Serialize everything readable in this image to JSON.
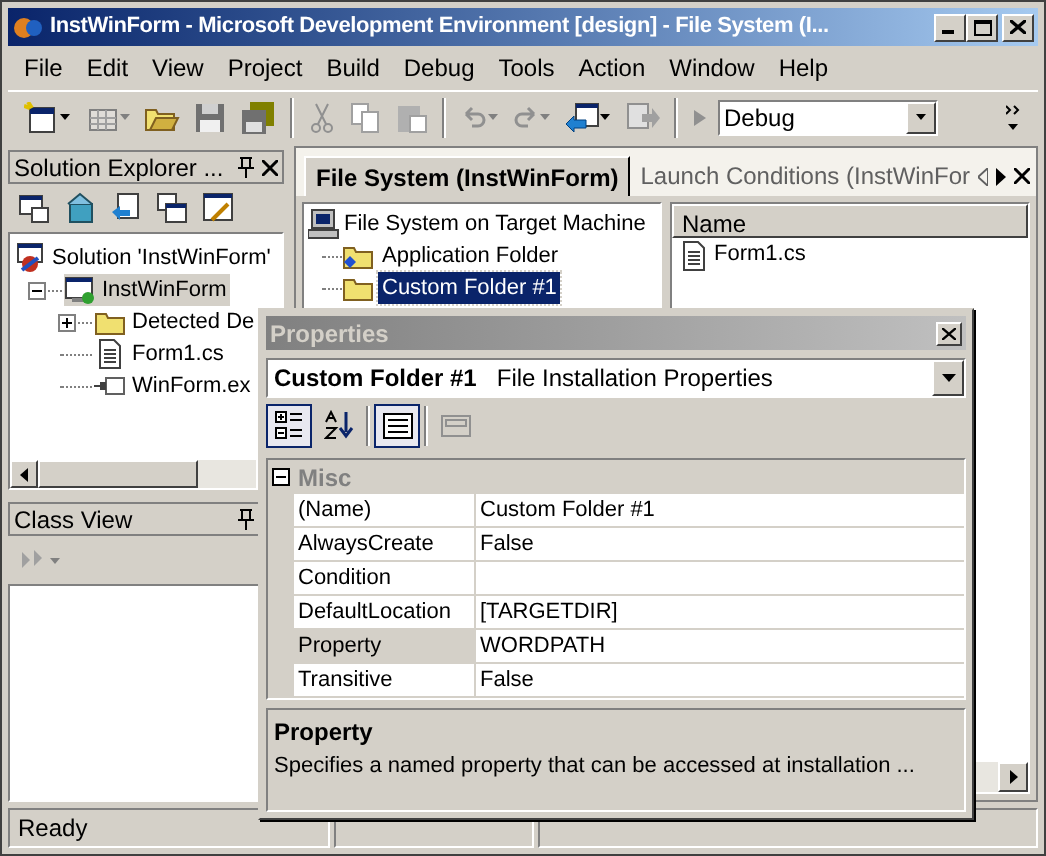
{
  "window": {
    "title": "InstWinForm - Microsoft Development Environment [design] - File System (I..."
  },
  "menu": [
    "File",
    "Edit",
    "View",
    "Project",
    "Build",
    "Debug",
    "Tools",
    "Action",
    "Window",
    "Help"
  ],
  "toolbar": {
    "configuration": "Debug"
  },
  "solution_explorer": {
    "title": "Solution Explorer ...",
    "tree": [
      {
        "label": "Solution 'InstWinForm'",
        "kind": "solution",
        "selected": false,
        "children": [
          {
            "label": "InstWinForm",
            "kind": "project",
            "selected": true,
            "expanded": true,
            "children": [
              {
                "label": "Detected De",
                "kind": "folder",
                "selected": false,
                "expanded": false
              },
              {
                "label": "Form1.cs",
                "kind": "file",
                "selected": false
              },
              {
                "label": "WinForm.ex",
                "kind": "output",
                "selected": false
              }
            ]
          }
        ]
      }
    ]
  },
  "class_view": {
    "title": "Class View"
  },
  "doc_tabs": [
    {
      "label": "File System (InstWinForm)",
      "selected": true
    },
    {
      "label": "Launch Conditions (InstWinFor",
      "selected": false
    }
  ],
  "file_system": {
    "root": "File System on Target Machine",
    "folders": [
      {
        "label": "Application Folder",
        "kind": "app",
        "selected": false
      },
      {
        "label": "Custom Folder #1",
        "kind": "custom",
        "selected": true
      }
    ]
  },
  "file_list": {
    "columns": [
      "Name"
    ],
    "items": [
      "Form1.cs"
    ]
  },
  "properties": {
    "title": "Properties",
    "object_name": "Custom Folder #1",
    "object_type": "File Installation Properties",
    "tools": [
      {
        "kind": "categorized",
        "pressed": true
      },
      {
        "kind": "alphabetical",
        "pressed": false
      },
      {
        "kind": "pages",
        "pressed": true
      },
      {
        "kind": "property_pages",
        "pressed": false
      }
    ],
    "category": {
      "label": "Misc",
      "expanded": true
    },
    "rows": [
      {
        "name": "(Name)",
        "value": "Custom Folder #1",
        "selected": false
      },
      {
        "name": "AlwaysCreate",
        "value": "False",
        "selected": false
      },
      {
        "name": "Condition",
        "selected": false
      },
      {
        "name": "DefaultLocation",
        "value": "[TARGETDIR]",
        "selected": false
      },
      {
        "name": "Property",
        "value": "WORDPATH",
        "selected": true
      },
      {
        "name": "Transitive",
        "value": "False",
        "selected": false
      }
    ],
    "description": {
      "title": "Property",
      "text": "Specifies a named property that can be accessed at installation ..."
    }
  },
  "status_bar": {
    "text": "Ready"
  }
}
